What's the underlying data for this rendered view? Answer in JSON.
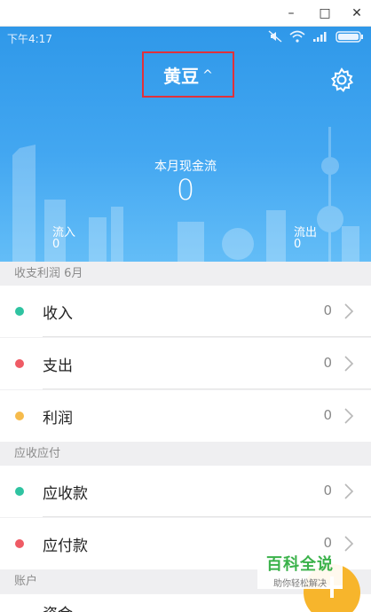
{
  "window": {
    "controls": {
      "minimize": "–",
      "maximize": "□",
      "close": "✕"
    }
  },
  "status_bar": {
    "time": "下午4:17",
    "icons": [
      "mute-icon",
      "wifi-icon",
      "signal-icon",
      "battery-icon"
    ]
  },
  "header": {
    "book_name": "黄豆",
    "caret": "^",
    "settings_icon": "gear-icon"
  },
  "summary": {
    "cashflow_label": "本月现金流",
    "cashflow_value": "0",
    "inflow_label": "流入",
    "inflow_value": "0",
    "outflow_label": "流出",
    "outflow_value": "0"
  },
  "sections": [
    {
      "title": "收支利润 6月",
      "rows": [
        {
          "label": "收入",
          "value": "0",
          "dot_color": "#2fc3a1"
        },
        {
          "label": "支出",
          "value": "0",
          "dot_color": "#ef5b65"
        },
        {
          "label": "利润",
          "value": "0",
          "dot_color": "#f6bb4c"
        }
      ]
    },
    {
      "title": "应收应付",
      "rows": [
        {
          "label": "应收款",
          "value": "0",
          "dot_color": "#2fc3a1"
        },
        {
          "label": "应付款",
          "value": "0",
          "dot_color": "#ef5b65"
        }
      ]
    },
    {
      "title": "账户",
      "rows": [
        {
          "label": "资金"
        }
      ]
    }
  ],
  "watermark": {
    "main": "百科全说",
    "sub": "助你轻松解决"
  },
  "colors": {
    "hero_top": "#2f98e9",
    "hero_bottom": "#63bdf7",
    "highlight_box": "#e0313b",
    "fab": "#f7b52c",
    "watermark_green": "#3ab24a"
  }
}
